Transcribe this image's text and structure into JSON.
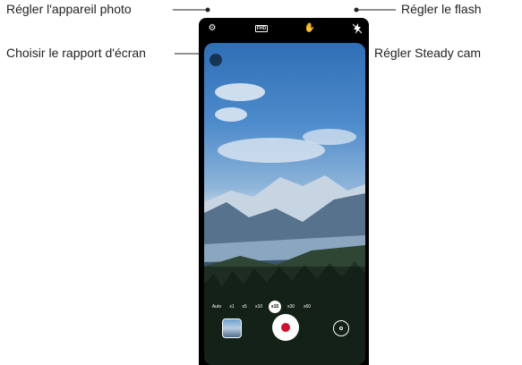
{
  "callouts": {
    "settings": "Régler l'appareil photo",
    "ratio": "Choisir le rapport d'écran",
    "flash": "Régler le flash",
    "steady": "Régler Steady cam"
  },
  "topbar": {
    "settings_icon": "gear-icon",
    "ratio_label": "FHD",
    "steady_icon": "hand-icon",
    "flash_icon": "flash-off-icon"
  },
  "zoom": {
    "items": [
      "Auto",
      "x1",
      "x5",
      "x10"
    ],
    "active": "x15",
    "items_after": [
      "x30",
      "x60"
    ]
  },
  "controls": {
    "gallery_icon": "gallery-thumbnail",
    "record_icon": "record-icon",
    "switch_icon": "switch-camera-icon",
    "record_color": "#d0112b"
  }
}
